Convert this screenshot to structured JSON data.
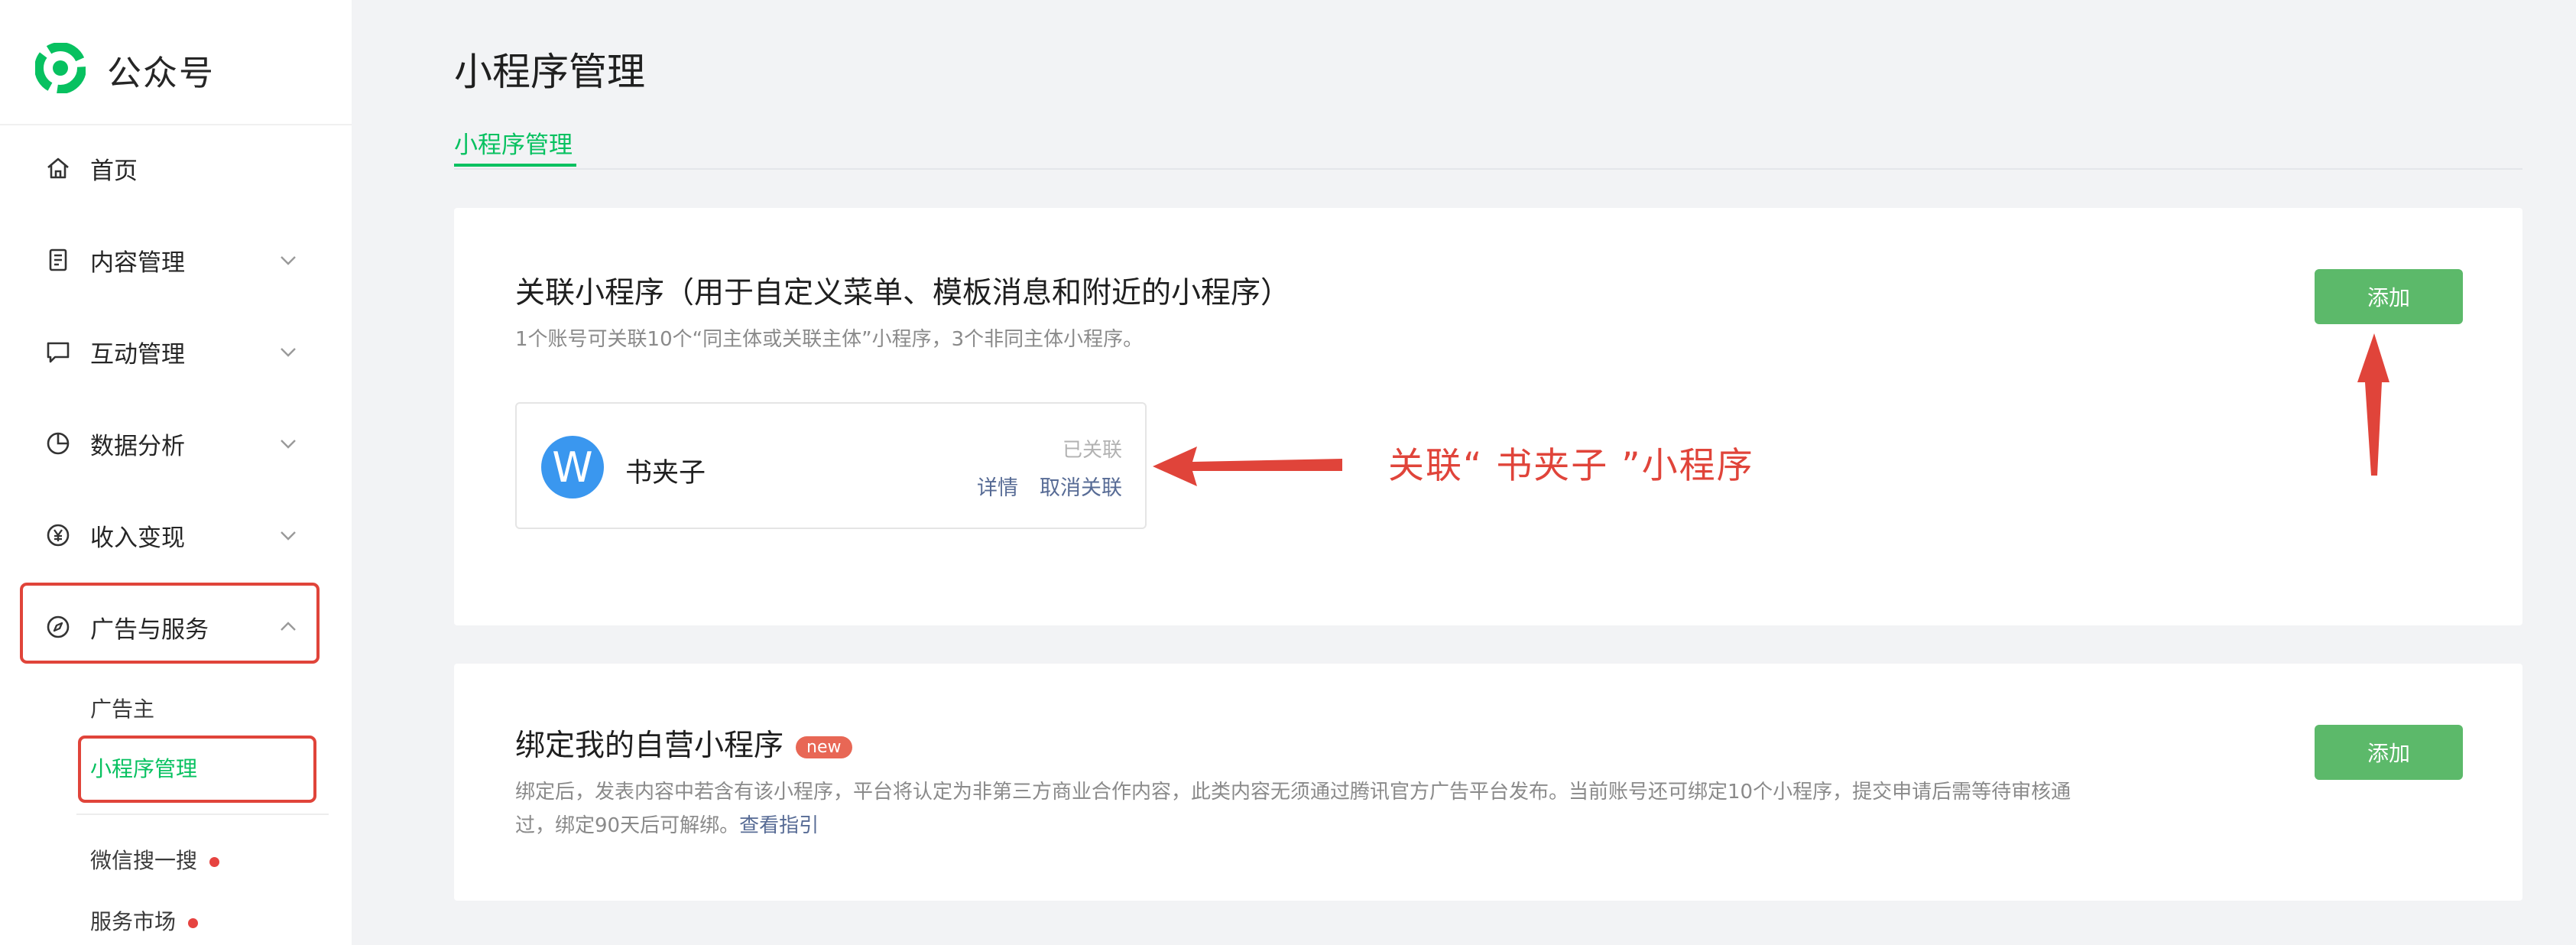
{
  "app": {
    "name": "公众号",
    "brand_color": "#07c160",
    "annotation_color": "#e0443a"
  },
  "sidebar": {
    "items": [
      {
        "label": "首页",
        "icon": "home-icon"
      },
      {
        "label": "内容管理",
        "icon": "document-icon"
      },
      {
        "label": "互动管理",
        "icon": "chat-icon"
      },
      {
        "label": "数据分析",
        "icon": "pie-chart-icon"
      },
      {
        "label": "收入变现",
        "icon": "yen-icon"
      },
      {
        "label": "广告与服务",
        "icon": "compass-icon"
      }
    ],
    "subitems": [
      {
        "label": "广告主"
      },
      {
        "label": "小程序管理"
      },
      {
        "label": "微信搜一搜"
      },
      {
        "label": "服务市场"
      }
    ]
  },
  "page": {
    "title": "小程序管理",
    "tab": "小程序管理"
  },
  "card1": {
    "title": "关联小程序（用于自定义菜单、模板消息和附近的小程序）",
    "desc": "1个账号可关联10个“同主体或关联主体”小程序，3个非同主体小程序。",
    "add_label": "添加",
    "mini_program": {
      "avatar_letter": "W",
      "name": "书夹子",
      "status": "已关联",
      "detail_label": "详情",
      "unlink_label": "取消关联"
    }
  },
  "card2": {
    "title": "绑定我的自营小程序",
    "badge": "new",
    "desc_line1": "绑定后，发表内容中若含有该小程序，平台将认定为非第三方商业合作内容，此类内容无须通过腾讯官方广告平台发布。当前账号还可绑定10个小程序，提交申请后需等待审核通",
    "desc_line2": "过，绑定90天后可解绑。",
    "guide_link": "查看指引",
    "add_label": "添加"
  },
  "annotation": {
    "text": "关联“ 书夹子 ”小程序"
  }
}
